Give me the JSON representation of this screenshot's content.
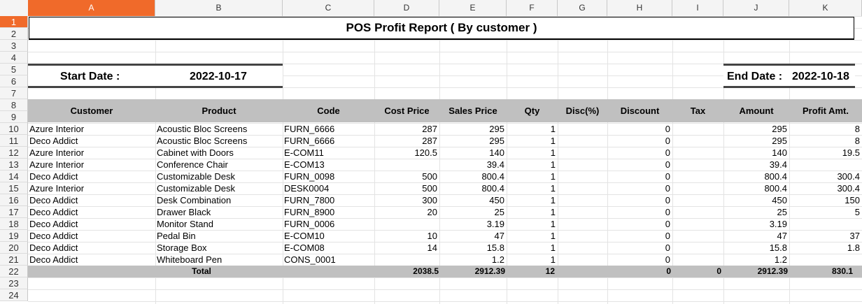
{
  "columns": [
    "A",
    "B",
    "C",
    "D",
    "E",
    "F",
    "G",
    "H",
    "I",
    "J",
    "K"
  ],
  "row_numbers": [
    "1",
    "2",
    "3",
    "4",
    "5",
    "6",
    "7",
    "8",
    "9",
    "10",
    "11",
    "12",
    "13",
    "14",
    "15",
    "16",
    "17",
    "18",
    "19",
    "20",
    "21",
    "22",
    "23",
    "24"
  ],
  "report": {
    "title": "POS Profit Report ( By customer )",
    "start_label": "Start Date :",
    "start_value": "2022-10-17",
    "end_label": "End Date :",
    "end_value": "2022-10-18"
  },
  "headers": [
    "Customer",
    "Product",
    "Code",
    "Cost Price",
    "Sales Price",
    "Qty",
    "Disc(%)",
    "Discount",
    "Tax",
    "Amount",
    "Profit Amt."
  ],
  "rows": [
    [
      "Azure Interior",
      "Acoustic Bloc Screens",
      "FURN_6666",
      "287",
      "295",
      "1",
      "",
      "0",
      "",
      "295",
      "8"
    ],
    [
      "Deco Addict",
      "Acoustic Bloc Screens",
      "FURN_6666",
      "287",
      "295",
      "1",
      "",
      "0",
      "",
      "295",
      "8"
    ],
    [
      "Azure Interior",
      "Cabinet with Doors",
      "E-COM11",
      "120.5",
      "140",
      "1",
      "",
      "0",
      "",
      "140",
      "19.5"
    ],
    [
      "Azure Interior",
      "Conference Chair",
      "E-COM13",
      "",
      "39.4",
      "1",
      "",
      "0",
      "",
      "39.4",
      ""
    ],
    [
      "Deco Addict",
      "Customizable Desk",
      "FURN_0098",
      "500",
      "800.4",
      "1",
      "",
      "0",
      "",
      "800.4",
      "300.4"
    ],
    [
      "Azure Interior",
      "Customizable Desk",
      "DESK0004",
      "500",
      "800.4",
      "1",
      "",
      "0",
      "",
      "800.4",
      "300.4"
    ],
    [
      "Deco Addict",
      "Desk Combination",
      "FURN_7800",
      "300",
      "450",
      "1",
      "",
      "0",
      "",
      "450",
      "150"
    ],
    [
      "Deco Addict",
      "Drawer Black",
      "FURN_8900",
      "20",
      "25",
      "1",
      "",
      "0",
      "",
      "25",
      "5"
    ],
    [
      "Deco Addict",
      "Monitor Stand",
      "FURN_0006",
      "",
      "3.19",
      "1",
      "",
      "0",
      "",
      "3.19",
      ""
    ],
    [
      "Deco Addict",
      "Pedal Bin",
      "E-COM10",
      "10",
      "47",
      "1",
      "",
      "0",
      "",
      "47",
      "37"
    ],
    [
      "Deco Addict",
      "Storage Box",
      "E-COM08",
      "14",
      "15.8",
      "1",
      "",
      "0",
      "",
      "15.8",
      "1.8"
    ],
    [
      "Deco Addict",
      "Whiteboard Pen",
      "CONS_0001",
      "",
      "1.2",
      "1",
      "",
      "0",
      "",
      "1.2",
      ""
    ]
  ],
  "total": {
    "label": "Total",
    "cost": "2038.5",
    "sales": "2912.39",
    "qty": "12",
    "discount": "0",
    "tax": "0",
    "amount": "2912.39",
    "profit": "830.1"
  },
  "colors": {
    "selected_header": "#f06a2a",
    "band": "#c0c0c0"
  }
}
